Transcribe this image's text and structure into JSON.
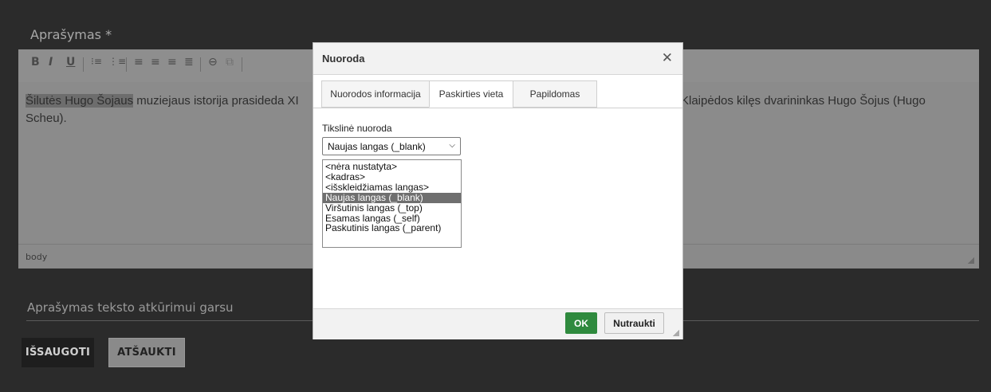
{
  "form": {
    "description_label": "Aprašymas *",
    "audio_label": "Aprašymas teksto atkūrimui garsu",
    "save_button": "IŠSAUGOTI",
    "cancel_button": "ATŠAUKTI"
  },
  "editor": {
    "toolbar": {
      "bold": "B",
      "italic": "I",
      "underline": "U",
      "numbered_list_icon": "⁝≡",
      "bullet_list_icon": "⋮≡",
      "align_left_icon": "≡",
      "align_center_icon": "≡",
      "align_right_icon": "≡",
      "justify_icon": "≣",
      "link_icon": "⊖",
      "unlink_icon": "⧉"
    },
    "content_highlight": "Šilutės Hugo Šojaus",
    "content_rest": " muziejaus istorija prasideda XI",
    "content_right": "Klaipėdos kilęs dvarininkas Hugo Šojus (Hugo",
    "content_line2": "Scheu).",
    "status_path": "body"
  },
  "dialog": {
    "title": "Nuoroda",
    "close_glyph": "✕",
    "tabs": [
      "Nuorodos informacija",
      "Paskirties vieta",
      "Papildomas"
    ],
    "active_tab": "Paskirties vieta",
    "target_label": "Tikslinė nuoroda",
    "target_selected": "Naujas langas (_blank)",
    "target_options": [
      "<nėra nustatyta>",
      "<kadras>",
      "<išskleidžiamas langas>",
      "Naujas langas (_blank)",
      "Viršutinis langas (_top)",
      "Esamas langas (_self)",
      "Paskutinis langas (_parent)"
    ],
    "ok_button": "OK",
    "cancel_button": "Nutraukti"
  },
  "colors": {
    "ok_green": "#2f8a3e",
    "background": "#2b2b2b",
    "editor_gray": "#8b8b8b"
  }
}
